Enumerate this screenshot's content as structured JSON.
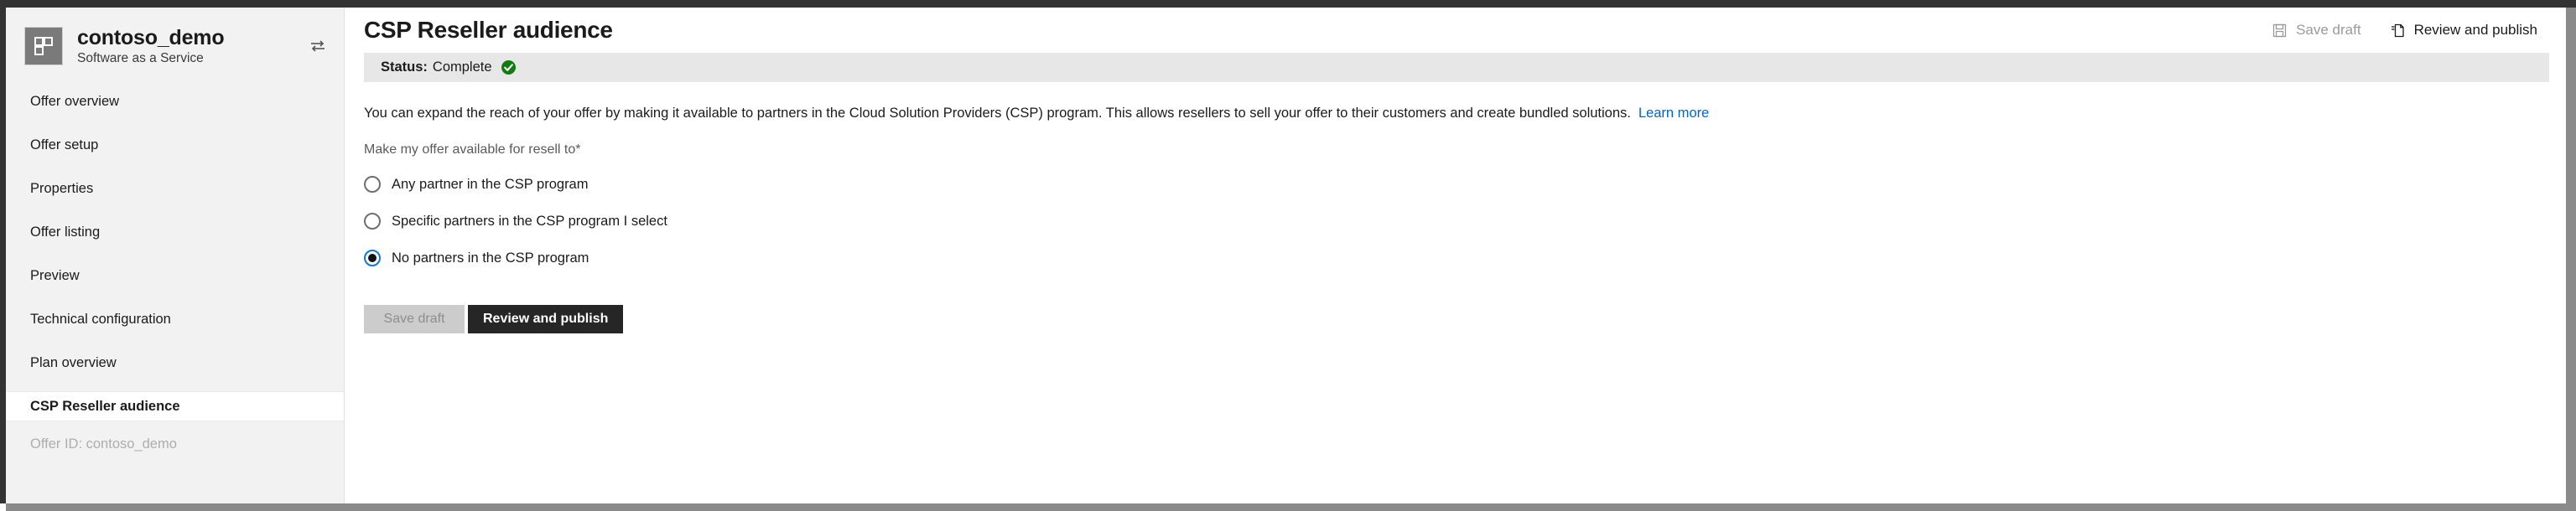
{
  "sidebar": {
    "app_name": "contoso_demo",
    "app_subtitle": "Software as a Service",
    "app_icon": "grid-tiles-icon",
    "switch_icon": "switch-arrows-icon",
    "items": [
      {
        "label": "Offer overview",
        "active": false
      },
      {
        "label": "Offer setup",
        "active": false
      },
      {
        "label": "Properties",
        "active": false
      },
      {
        "label": "Offer listing",
        "active": false
      },
      {
        "label": "Preview",
        "active": false
      },
      {
        "label": "Technical configuration",
        "active": false
      },
      {
        "label": "Plan overview",
        "active": false
      },
      {
        "label": "CSP Reseller audience",
        "active": true
      }
    ],
    "offer_id": "Offer ID: contoso_demo"
  },
  "header": {
    "title": "CSP Reseller audience",
    "save_draft_label": "Save draft",
    "save_draft_icon": "save-disk-icon",
    "review_publish_label": "Review and publish",
    "review_publish_icon": "publish-page-icon"
  },
  "status": {
    "label": "Status:",
    "value": "Complete",
    "icon": "green-check-circle-icon",
    "color": "#107c10"
  },
  "main": {
    "description": "You can expand the reach of your offer by making it available to partners in the Cloud Solution Providers (CSP) program. This allows resellers to sell your offer to their customers and create bundled solutions.",
    "learn_more": "Learn more",
    "learn_more_color": "#0066cc",
    "field_label": "Make my offer available for resell to",
    "required_marker": "*",
    "radio_options": [
      {
        "label": "Any partner in the CSP program",
        "selected": false
      },
      {
        "label": "Specific partners in the CSP program I select",
        "selected": false
      },
      {
        "label": "No partners in the CSP program",
        "selected": true
      }
    ],
    "buttons": {
      "save_draft": "Save draft",
      "review_publish": "Review and publish"
    }
  }
}
